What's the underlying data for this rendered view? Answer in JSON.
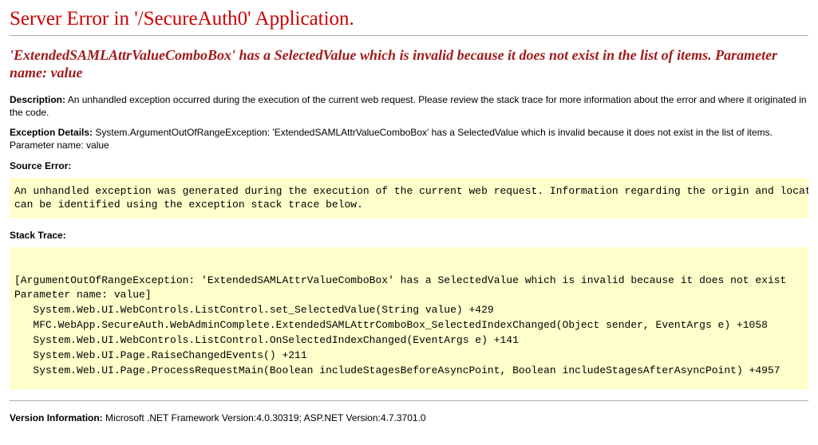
{
  "header": {
    "title": "Server Error in '/SecureAuth0' Application."
  },
  "error": {
    "message": "'ExtendedSAMLAttrValueComboBox' has a SelectedValue which is invalid because it does not exist in the list of items.\nParameter name: value"
  },
  "description": {
    "label": "Description:",
    "text": "An unhandled exception occurred during the execution of the current web request. Please review the stack trace for more information about the error and where it originated in the code."
  },
  "exception": {
    "label": "Exception Details:",
    "text": "System.ArgumentOutOfRangeException: 'ExtendedSAMLAttrValueComboBox' has a SelectedValue which is invalid because it does not exist in the list of items.\nParameter name: value"
  },
  "source_error": {
    "label": "Source Error:",
    "box": "An unhandled exception was generated during the execution of the current web request. Information regarding the origin and location of the exception\ncan be identified using the exception stack trace below."
  },
  "stack_trace": {
    "label": "Stack Trace:",
    "box": "\n[ArgumentOutOfRangeException: 'ExtendedSAMLAttrValueComboBox' has a SelectedValue which is invalid because it does not exist\nParameter name: value]\n   System.Web.UI.WebControls.ListControl.set_SelectedValue(String value) +429\n   MFC.WebApp.SecureAuth.WebAdminComplete.ExtendedSAMLAttrComboBox_SelectedIndexChanged(Object sender, EventArgs e) +1058\n   System.Web.UI.WebControls.ListControl.OnSelectedIndexChanged(EventArgs e) +141\n   System.Web.UI.Page.RaiseChangedEvents() +211\n   System.Web.UI.Page.ProcessRequestMain(Boolean includeStagesBeforeAsyncPoint, Boolean includeStagesAfterAsyncPoint) +4957\n"
  },
  "version": {
    "label": "Version Information:",
    "text": "Microsoft .NET Framework Version:4.0.30319; ASP.NET Version:4.7.3701.0"
  }
}
